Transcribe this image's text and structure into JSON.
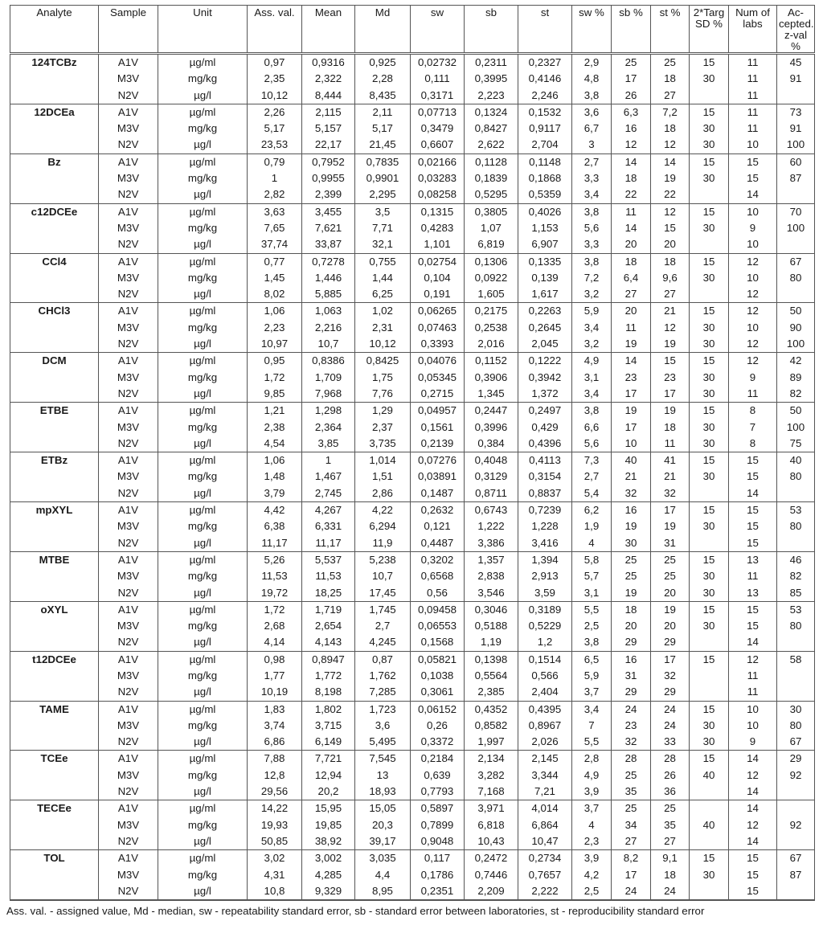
{
  "table": {
    "headers": [
      "Analyte",
      "Sample",
      "Unit",
      "Ass. val.",
      "Mean",
      "Md",
      "sw",
      "sb",
      "st",
      "sw %",
      "sb %",
      "st %",
      "2*Targ SD %",
      "Num of labs",
      "Ac-cepted. z-val %"
    ],
    "groups": [
      {
        "analyte": "124TCBz",
        "rows": [
          [
            "A1V",
            "µg/ml",
            "0,97",
            "0,9316",
            "0,925",
            "0,02732",
            "0,2311",
            "0,2327",
            "2,9",
            "25",
            "25",
            "15",
            "11",
            "45"
          ],
          [
            "M3V",
            "mg/kg",
            "2,35",
            "2,322",
            "2,28",
            "0,111",
            "0,3995",
            "0,4146",
            "4,8",
            "17",
            "18",
            "30",
            "11",
            "91"
          ],
          [
            "N2V",
            "µg/l",
            "10,12",
            "8,444",
            "8,435",
            "0,3171",
            "2,223",
            "2,246",
            "3,8",
            "26",
            "27",
            "",
            "11",
            ""
          ]
        ]
      },
      {
        "analyte": "12DCEa",
        "rows": [
          [
            "A1V",
            "µg/ml",
            "2,26",
            "2,115",
            "2,11",
            "0,07713",
            "0,1324",
            "0,1532",
            "3,6",
            "6,3",
            "7,2",
            "15",
            "11",
            "73"
          ],
          [
            "M3V",
            "mg/kg",
            "5,17",
            "5,157",
            "5,17",
            "0,3479",
            "0,8427",
            "0,9117",
            "6,7",
            "16",
            "18",
            "30",
            "11",
            "91"
          ],
          [
            "N2V",
            "µg/l",
            "23,53",
            "22,17",
            "21,45",
            "0,6607",
            "2,622",
            "2,704",
            "3",
            "12",
            "12",
            "30",
            "10",
            "100"
          ]
        ]
      },
      {
        "analyte": "Bz",
        "rows": [
          [
            "A1V",
            "µg/ml",
            "0,79",
            "0,7952",
            "0,7835",
            "0,02166",
            "0,1128",
            "0,1148",
            "2,7",
            "14",
            "14",
            "15",
            "15",
            "60"
          ],
          [
            "M3V",
            "mg/kg",
            "1",
            "0,9955",
            "0,9901",
            "0,03283",
            "0,1839",
            "0,1868",
            "3,3",
            "18",
            "19",
            "30",
            "15",
            "87"
          ],
          [
            "N2V",
            "µg/l",
            "2,82",
            "2,399",
            "2,295",
            "0,08258",
            "0,5295",
            "0,5359",
            "3,4",
            "22",
            "22",
            "",
            "14",
            ""
          ]
        ]
      },
      {
        "analyte": "c12DCEe",
        "rows": [
          [
            "A1V",
            "µg/ml",
            "3,63",
            "3,455",
            "3,5",
            "0,1315",
            "0,3805",
            "0,4026",
            "3,8",
            "11",
            "12",
            "15",
            "10",
            "70"
          ],
          [
            "M3V",
            "mg/kg",
            "7,65",
            "7,621",
            "7,71",
            "0,4283",
            "1,07",
            "1,153",
            "5,6",
            "14",
            "15",
            "30",
            "9",
            "100"
          ],
          [
            "N2V",
            "µg/l",
            "37,74",
            "33,87",
            "32,1",
            "1,101",
            "6,819",
            "6,907",
            "3,3",
            "20",
            "20",
            "",
            "10",
            ""
          ]
        ]
      },
      {
        "analyte": "CCl4",
        "rows": [
          [
            "A1V",
            "µg/ml",
            "0,77",
            "0,7278",
            "0,755",
            "0,02754",
            "0,1306",
            "0,1335",
            "3,8",
            "18",
            "18",
            "15",
            "12",
            "67"
          ],
          [
            "M3V",
            "mg/kg",
            "1,45",
            "1,446",
            "1,44",
            "0,104",
            "0,0922",
            "0,139",
            "7,2",
            "6,4",
            "9,6",
            "30",
            "10",
            "80"
          ],
          [
            "N2V",
            "µg/l",
            "8,02",
            "5,885",
            "6,25",
            "0,191",
            "1,605",
            "1,617",
            "3,2",
            "27",
            "27",
            "",
            "12",
            ""
          ]
        ]
      },
      {
        "analyte": "CHCl3",
        "rows": [
          [
            "A1V",
            "µg/ml",
            "1,06",
            "1,063",
            "1,02",
            "0,06265",
            "0,2175",
            "0,2263",
            "5,9",
            "20",
            "21",
            "15",
            "12",
            "50"
          ],
          [
            "M3V",
            "mg/kg",
            "2,23",
            "2,216",
            "2,31",
            "0,07463",
            "0,2538",
            "0,2645",
            "3,4",
            "11",
            "12",
            "30",
            "10",
            "90"
          ],
          [
            "N2V",
            "µg/l",
            "10,97",
            "10,7",
            "10,12",
            "0,3393",
            "2,016",
            "2,045",
            "3,2",
            "19",
            "19",
            "30",
            "12",
            "100"
          ]
        ]
      },
      {
        "analyte": "DCM",
        "rows": [
          [
            "A1V",
            "µg/ml",
            "0,95",
            "0,8386",
            "0,8425",
            "0,04076",
            "0,1152",
            "0,1222",
            "4,9",
            "14",
            "15",
            "15",
            "12",
            "42"
          ],
          [
            "M3V",
            "mg/kg",
            "1,72",
            "1,709",
            "1,75",
            "0,05345",
            "0,3906",
            "0,3942",
            "3,1",
            "23",
            "23",
            "30",
            "9",
            "89"
          ],
          [
            "N2V",
            "µg/l",
            "9,85",
            "7,968",
            "7,76",
            "0,2715",
            "1,345",
            "1,372",
            "3,4",
            "17",
            "17",
            "30",
            "11",
            "82"
          ]
        ]
      },
      {
        "analyte": "ETBE",
        "rows": [
          [
            "A1V",
            "µg/ml",
            "1,21",
            "1,298",
            "1,29",
            "0,04957",
            "0,2447",
            "0,2497",
            "3,8",
            "19",
            "19",
            "15",
            "8",
            "50"
          ],
          [
            "M3V",
            "mg/kg",
            "2,38",
            "2,364",
            "2,37",
            "0,1561",
            "0,3996",
            "0,429",
            "6,6",
            "17",
            "18",
            "30",
            "7",
            "100"
          ],
          [
            "N2V",
            "µg/l",
            "4,54",
            "3,85",
            "3,735",
            "0,2139",
            "0,384",
            "0,4396",
            "5,6",
            "10",
            "11",
            "30",
            "8",
            "75"
          ]
        ]
      },
      {
        "analyte": "ETBz",
        "rows": [
          [
            "A1V",
            "µg/ml",
            "1,06",
            "1",
            "1,014",
            "0,07276",
            "0,4048",
            "0,4113",
            "7,3",
            "40",
            "41",
            "15",
            "15",
            "40"
          ],
          [
            "M3V",
            "mg/kg",
            "1,48",
            "1,467",
            "1,51",
            "0,03891",
            "0,3129",
            "0,3154",
            "2,7",
            "21",
            "21",
            "30",
            "15",
            "80"
          ],
          [
            "N2V",
            "µg/l",
            "3,79",
            "2,745",
            "2,86",
            "0,1487",
            "0,8711",
            "0,8837",
            "5,4",
            "32",
            "32",
            "",
            "14",
            ""
          ]
        ]
      },
      {
        "analyte": "mpXYL",
        "rows": [
          [
            "A1V",
            "µg/ml",
            "4,42",
            "4,267",
            "4,22",
            "0,2632",
            "0,6743",
            "0,7239",
            "6,2",
            "16",
            "17",
            "15",
            "15",
            "53"
          ],
          [
            "M3V",
            "mg/kg",
            "6,38",
            "6,331",
            "6,294",
            "0,121",
            "1,222",
            "1,228",
            "1,9",
            "19",
            "19",
            "30",
            "15",
            "80"
          ],
          [
            "N2V",
            "µg/l",
            "11,17",
            "11,17",
            "11,9",
            "0,4487",
            "3,386",
            "3,416",
            "4",
            "30",
            "31",
            "",
            "15",
            ""
          ]
        ]
      },
      {
        "analyte": "MTBE",
        "rows": [
          [
            "A1V",
            "µg/ml",
            "5,26",
            "5,537",
            "5,238",
            "0,3202",
            "1,357",
            "1,394",
            "5,8",
            "25",
            "25",
            "15",
            "13",
            "46"
          ],
          [
            "M3V",
            "mg/kg",
            "11,53",
            "11,53",
            "10,7",
            "0,6568",
            "2,838",
            "2,913",
            "5,7",
            "25",
            "25",
            "30",
            "11",
            "82"
          ],
          [
            "N2V",
            "µg/l",
            "19,72",
            "18,25",
            "17,45",
            "0,56",
            "3,546",
            "3,59",
            "3,1",
            "19",
            "20",
            "30",
            "13",
            "85"
          ]
        ]
      },
      {
        "analyte": "oXYL",
        "rows": [
          [
            "A1V",
            "µg/ml",
            "1,72",
            "1,719",
            "1,745",
            "0,09458",
            "0,3046",
            "0,3189",
            "5,5",
            "18",
            "19",
            "15",
            "15",
            "53"
          ],
          [
            "M3V",
            "mg/kg",
            "2,68",
            "2,654",
            "2,7",
            "0,06553",
            "0,5188",
            "0,5229",
            "2,5",
            "20",
            "20",
            "30",
            "15",
            "80"
          ],
          [
            "N2V",
            "µg/l",
            "4,14",
            "4,143",
            "4,245",
            "0,1568",
            "1,19",
            "1,2",
            "3,8",
            "29",
            "29",
            "",
            "14",
            ""
          ]
        ]
      },
      {
        "analyte": "t12DCEe",
        "rows": [
          [
            "A1V",
            "µg/ml",
            "0,98",
            "0,8947",
            "0,87",
            "0,05821",
            "0,1398",
            "0,1514",
            "6,5",
            "16",
            "17",
            "15",
            "12",
            "58"
          ],
          [
            "M3V",
            "mg/kg",
            "1,77",
            "1,772",
            "1,762",
            "0,1038",
            "0,5564",
            "0,566",
            "5,9",
            "31",
            "32",
            "",
            "11",
            ""
          ],
          [
            "N2V",
            "µg/l",
            "10,19",
            "8,198",
            "7,285",
            "0,3061",
            "2,385",
            "2,404",
            "3,7",
            "29",
            "29",
            "",
            "11",
            ""
          ]
        ]
      },
      {
        "analyte": "TAME",
        "rows": [
          [
            "A1V",
            "µg/ml",
            "1,83",
            "1,802",
            "1,723",
            "0,06152",
            "0,4352",
            "0,4395",
            "3,4",
            "24",
            "24",
            "15",
            "10",
            "30"
          ],
          [
            "M3V",
            "mg/kg",
            "3,74",
            "3,715",
            "3,6",
            "0,26",
            "0,8582",
            "0,8967",
            "7",
            "23",
            "24",
            "30",
            "10",
            "80"
          ],
          [
            "N2V",
            "µg/l",
            "6,86",
            "6,149",
            "5,495",
            "0,3372",
            "1,997",
            "2,026",
            "5,5",
            "32",
            "33",
            "30",
            "9",
            "67"
          ]
        ]
      },
      {
        "analyte": "TCEe",
        "rows": [
          [
            "A1V",
            "µg/ml",
            "7,88",
            "7,721",
            "7,545",
            "0,2184",
            "2,134",
            "2,145",
            "2,8",
            "28",
            "28",
            "15",
            "14",
            "29"
          ],
          [
            "M3V",
            "mg/kg",
            "12,8",
            "12,94",
            "13",
            "0,639",
            "3,282",
            "3,344",
            "4,9",
            "25",
            "26",
            "40",
            "12",
            "92"
          ],
          [
            "N2V",
            "µg/l",
            "29,56",
            "20,2",
            "18,93",
            "0,7793",
            "7,168",
            "7,21",
            "3,9",
            "35",
            "36",
            "",
            "14",
            ""
          ]
        ]
      },
      {
        "analyte": "TECEe",
        "rows": [
          [
            "A1V",
            "µg/ml",
            "14,22",
            "15,95",
            "15,05",
            "0,5897",
            "3,971",
            "4,014",
            "3,7",
            "25",
            "25",
            "",
            "14",
            ""
          ],
          [
            "M3V",
            "mg/kg",
            "19,93",
            "19,85",
            "20,3",
            "0,7899",
            "6,818",
            "6,864",
            "4",
            "34",
            "35",
            "40",
            "12",
            "92"
          ],
          [
            "N2V",
            "µg/l",
            "50,85",
            "38,92",
            "39,17",
            "0,9048",
            "10,43",
            "10,47",
            "2,3",
            "27",
            "27",
            "",
            "14",
            ""
          ]
        ]
      },
      {
        "analyte": "TOL",
        "rows": [
          [
            "A1V",
            "µg/ml",
            "3,02",
            "3,002",
            "3,035",
            "0,117",
            "0,2472",
            "0,2734",
            "3,9",
            "8,2",
            "9,1",
            "15",
            "15",
            "67"
          ],
          [
            "M3V",
            "mg/kg",
            "4,31",
            "4,285",
            "4,4",
            "0,1786",
            "0,7446",
            "0,7657",
            "4,2",
            "17",
            "18",
            "30",
            "15",
            "87"
          ],
          [
            "N2V",
            "µg/l",
            "10,8",
            "9,329",
            "8,95",
            "0,2351",
            "2,209",
            "2,222",
            "2,5",
            "24",
            "24",
            "",
            "15",
            ""
          ]
        ]
      }
    ]
  },
  "footnote": "Ass. val. - assigned value, Md - median, sw - repeatability standard error, sb - standard error between laboratories, st - reproducibility standard error"
}
